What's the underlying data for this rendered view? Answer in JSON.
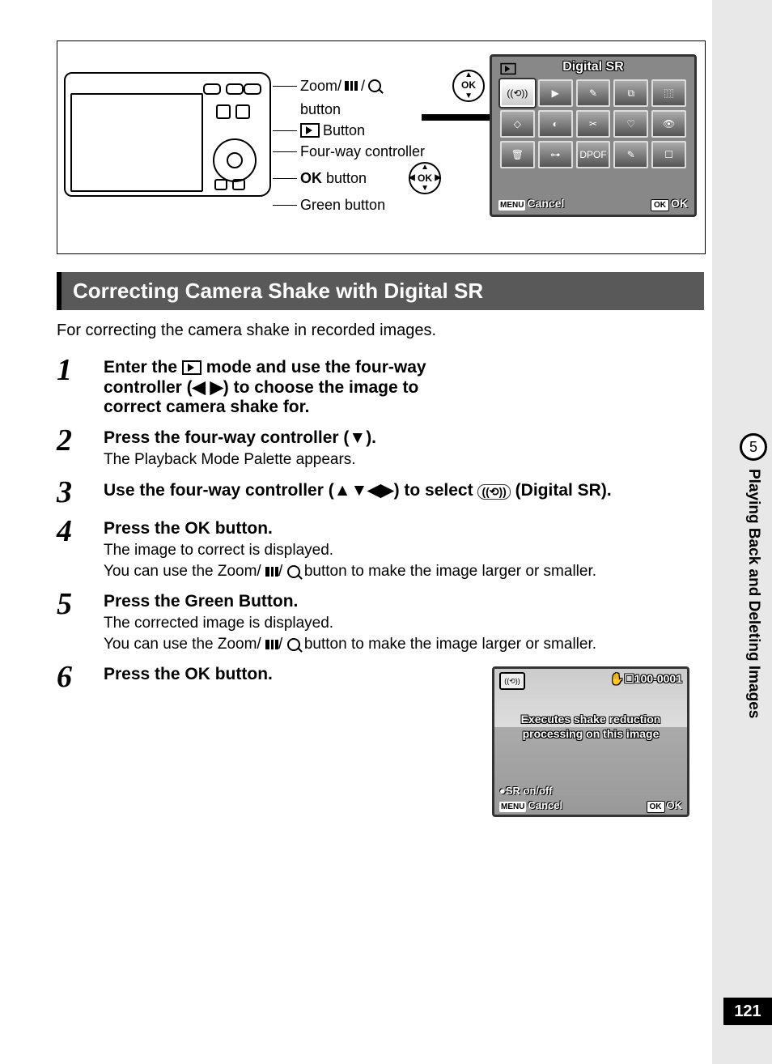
{
  "hero": {
    "labels": {
      "zoom_prefix": "Zoom/",
      "zoom_suffix": " button",
      "play_button": " Button",
      "four_way": "Four-way controller",
      "ok_button_prefix": "OK",
      "ok_button_suffix": " button",
      "green_button": "Green button"
    },
    "palette": {
      "title": "Digital SR",
      "cancel": "Cancel",
      "ok": "OK"
    }
  },
  "section_title": "Correcting Camera Shake with Digital SR",
  "intro": "For correcting the camera shake in recorded images.",
  "preview": {
    "counter": "100-0001",
    "msg_line1": "Executes shake reduction",
    "msg_line2": "processing on this image",
    "sr_onoff": "SR on/off",
    "cancel": "Cancel",
    "ok": "OK"
  },
  "steps": [
    {
      "num": "1",
      "head_parts": [
        "Enter the ",
        " mode and use the four-way controller (◀ ▶) to choose the image to correct camera shake for."
      ]
    },
    {
      "num": "2",
      "head": "Press the four-way controller (▼).",
      "sub": "The Playback Mode Palette appears."
    },
    {
      "num": "3",
      "head": "Use the four-way controller (▲▼◀▶) to select ",
      "head_tail": " (Digital SR)."
    },
    {
      "num": "4",
      "head_pre": "Press the ",
      "head_ok": "OK",
      "head_post": " button.",
      "sub1": "The image to correct is displayed.",
      "sub2a": "You can use the Zoom/",
      "sub2b": " button to make the image larger or smaller."
    },
    {
      "num": "5",
      "head": "Press the Green Button.",
      "sub1": "The corrected image is displayed.",
      "sub2a": "You can use the Zoom/",
      "sub2b": " button to make the image larger or smaller."
    },
    {
      "num": "6",
      "head_pre": "Press the ",
      "head_ok": "OK",
      "head_post": " button."
    }
  ],
  "sidebar": {
    "chapter": "5",
    "title": "Playing Back and Deleting Images"
  },
  "page_number": "121"
}
